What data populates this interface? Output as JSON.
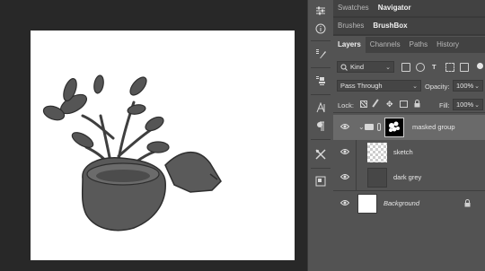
{
  "top_tabs": [
    "Swatches",
    "Navigator"
  ],
  "brush_tabs": [
    "Brushes",
    "BrushBox"
  ],
  "layer_tabs": [
    "Layers",
    "Channels",
    "Paths",
    "History"
  ],
  "filter": {
    "kind": "Kind"
  },
  "blend": {
    "mode": "Pass Through",
    "opacity_label": "Opacity:",
    "opacity_value": "100%"
  },
  "lock": {
    "label": "Lock:",
    "fill_label": "Fill:",
    "fill_value": "100%"
  },
  "layers": [
    {
      "name": "masked group"
    },
    {
      "name": "sketch"
    },
    {
      "name": "dark grey"
    },
    {
      "name": "Background"
    }
  ],
  "colors": {
    "panel_bg": "#535353",
    "tab_bar": "#424242",
    "selected_row": "#6a6a6a",
    "canvas_bg": "#282828"
  },
  "icons": [
    "sliders-icon",
    "info-icon",
    "brush-settings-icon",
    "brush-presets-icon",
    "clone-source-icon",
    "character-icon",
    "paragraph-icon",
    "tools-icon",
    "artboard-icon"
  ]
}
